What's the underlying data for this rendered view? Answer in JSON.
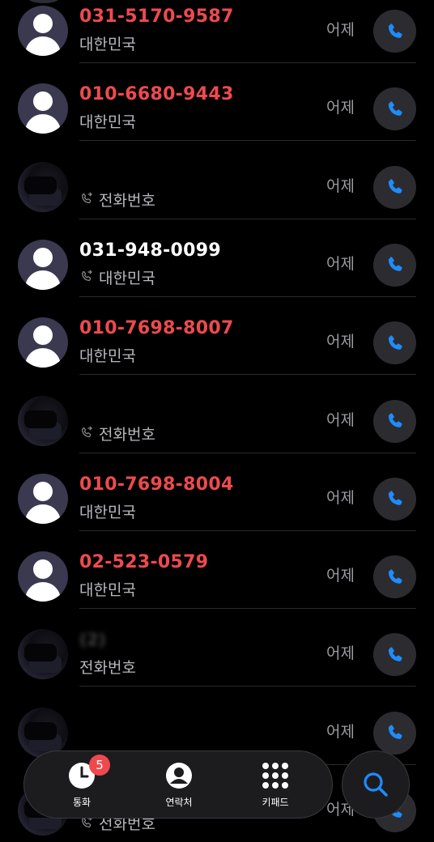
{
  "recents": [
    {
      "number": "031-5170-9587",
      "detail": "대한민국",
      "time": "어제",
      "style": "missed",
      "avatar": "default",
      "detail_icon": false
    },
    {
      "number": "010-6680-9443",
      "detail": "대한민국",
      "time": "어제",
      "style": "missed",
      "avatar": "default",
      "detail_icon": false
    },
    {
      "number": "",
      "detail": "전화번호",
      "time": "어제",
      "style": "blurred",
      "avatar": "photo",
      "detail_icon": true
    },
    {
      "number": "031-948-0099",
      "detail": "대한민국",
      "time": "어제",
      "style": "normal",
      "avatar": "default",
      "detail_icon": true
    },
    {
      "number": "010-7698-8007",
      "detail": "대한민국",
      "time": "어제",
      "style": "missed",
      "avatar": "default",
      "detail_icon": false
    },
    {
      "number": "",
      "detail": "전화번호",
      "time": "어제",
      "style": "blurred",
      "avatar": "photo",
      "detail_icon": true
    },
    {
      "number": "010-7698-8004",
      "detail": "대한민국",
      "time": "어제",
      "style": "missed",
      "avatar": "default",
      "detail_icon": false
    },
    {
      "number": "02-523-0579",
      "detail": "대한민국",
      "time": "어제",
      "style": "missed",
      "avatar": "default",
      "detail_icon": false
    },
    {
      "number": "(2)",
      "detail": "전화번호",
      "time": "어제",
      "style": "blurred",
      "avatar": "photo",
      "detail_icon": false
    },
    {
      "number": "",
      "detail": "",
      "time": "어제",
      "style": "blurred",
      "avatar": "photo",
      "detail_icon": false
    },
    {
      "number": "",
      "detail": "전화번호",
      "time": "어제",
      "style": "blurred",
      "avatar": "photo",
      "detail_icon": true
    }
  ],
  "nav": {
    "tabs": [
      {
        "label": "통화",
        "icon": "clock-icon",
        "badge": "5"
      },
      {
        "label": "연락처",
        "icon": "person-circle-icon"
      },
      {
        "label": "키패드",
        "icon": "keypad-icon"
      }
    ],
    "search_icon": "search-icon"
  },
  "colors": {
    "missed": "#ee4a4e",
    "accent": "#1e8cff",
    "background": "#000000"
  }
}
